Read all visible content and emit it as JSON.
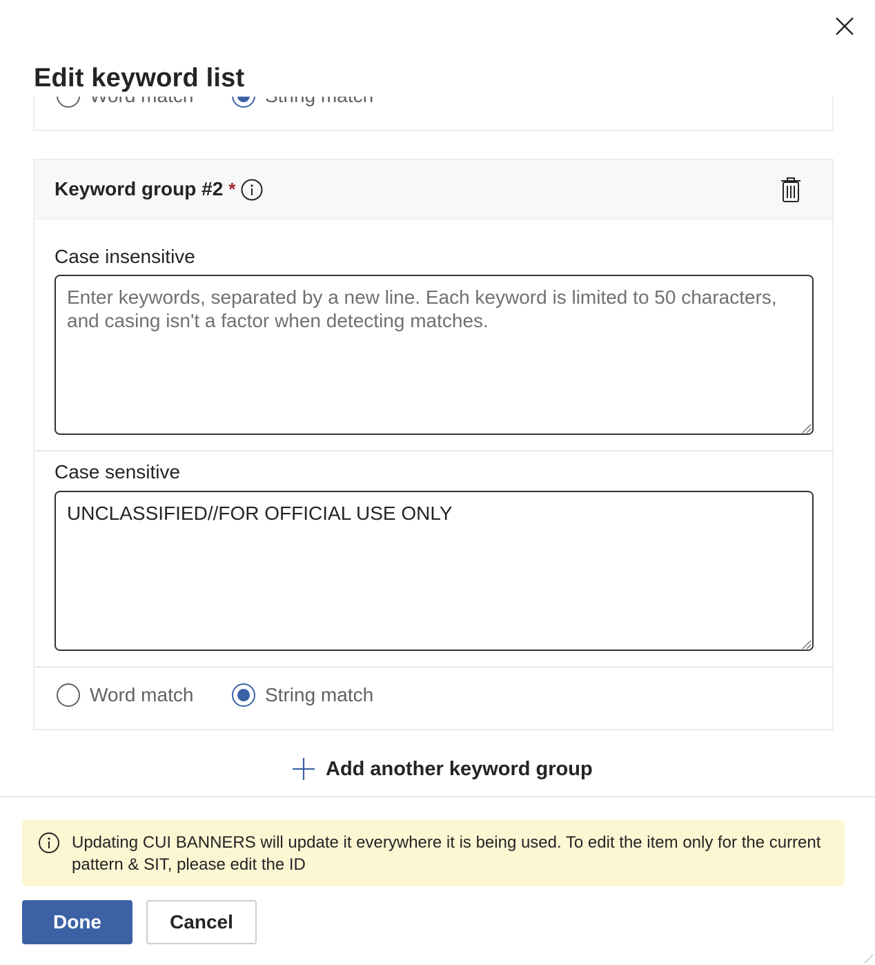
{
  "panel": {
    "title": "Edit keyword list",
    "close_icon": "close-icon"
  },
  "previous_group": {
    "match_options": [
      {
        "label": "Word match",
        "checked": false
      },
      {
        "label": "String match",
        "checked": true
      }
    ]
  },
  "keyword_group": {
    "title": "Keyword group #2",
    "required_marker": "*",
    "info_icon": "info-icon",
    "delete_icon": "trash-icon",
    "case_insensitive": {
      "label": "Case insensitive",
      "value": "",
      "placeholder": "Enter keywords, separated by a new line. Each keyword is limited to 50 characters, and casing isn't a factor when detecting matches."
    },
    "case_sensitive": {
      "label": "Case sensitive",
      "value": "UNCLASSIFIED//FOR OFFICIAL USE ONLY",
      "placeholder": ""
    },
    "match_options": [
      {
        "label": "Word match",
        "checked": false
      },
      {
        "label": "String match",
        "checked": true
      }
    ]
  },
  "add_group": {
    "label": "Add another keyword group",
    "icon": "plus-icon"
  },
  "notice": {
    "icon": "info-icon",
    "text": "Updating CUI BANNERS will update it everywhere it is being used. To edit the item only for the current pattern & SIT, please edit the ID"
  },
  "actions": {
    "done_label": "Done",
    "cancel_label": "Cancel"
  },
  "colors": {
    "primary": "#3c62a5",
    "notice_bg": "#fdf6d3",
    "required": "#a4262c"
  }
}
